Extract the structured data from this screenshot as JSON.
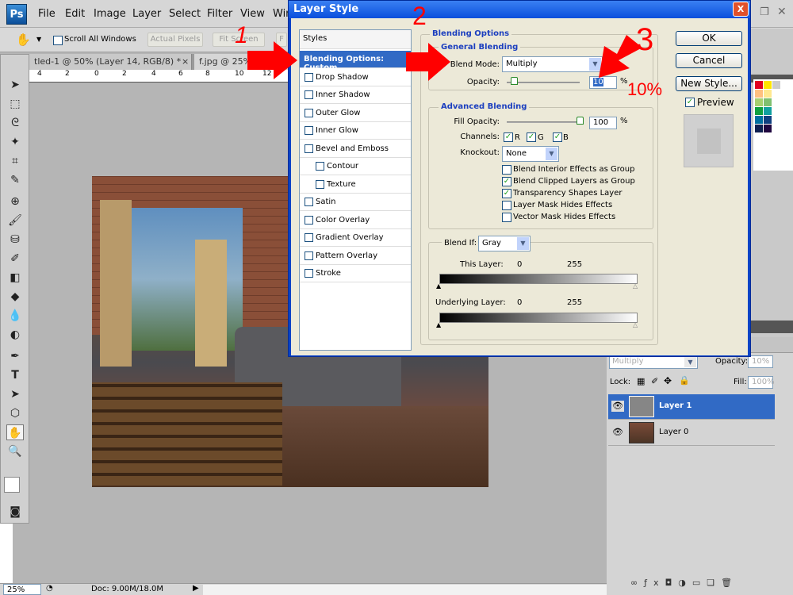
{
  "app": {
    "logo": "Ps",
    "menu": [
      "File",
      "Edit",
      "Image",
      "Layer",
      "Select",
      "Filter",
      "View",
      "Win"
    ]
  },
  "options": {
    "scroll_all": "Scroll All Windows",
    "actual_pixels": "Actual Pixels",
    "fit_screen": "Fit Screen",
    "fill_screen": "F"
  },
  "tabs": [
    {
      "label": "tled-1 @ 50% (Layer 14, RGB/8) *",
      "close": "×"
    },
    {
      "label": "f.jpg @ 25%"
    }
  ],
  "ruler": [
    "4",
    "2",
    "0",
    "2",
    "4",
    "6",
    "8",
    "10",
    "12"
  ],
  "status": {
    "zoom": "25%",
    "doc": "Doc: 9.00M/18.0M"
  },
  "dialog": {
    "title": "Layer Style",
    "close": "X",
    "styles": [
      {
        "label": "Styles",
        "type": "header"
      },
      {
        "label": "Blending Options: Custom",
        "type": "selected"
      },
      {
        "label": "Drop Shadow",
        "checked": false
      },
      {
        "label": "Inner Shadow",
        "checked": false
      },
      {
        "label": "Outer Glow",
        "checked": false
      },
      {
        "label": "Inner Glow",
        "checked": false
      },
      {
        "label": "Bevel and Emboss",
        "checked": false
      },
      {
        "label": "Contour",
        "checked": false,
        "indent": true
      },
      {
        "label": "Texture",
        "checked": false,
        "indent": true
      },
      {
        "label": "Satin",
        "checked": false
      },
      {
        "label": "Color Overlay",
        "checked": false
      },
      {
        "label": "Gradient Overlay",
        "checked": false
      },
      {
        "label": "Pattern Overlay",
        "checked": false
      },
      {
        "label": "Stroke",
        "checked": false
      }
    ],
    "blending_options": "Blending Options",
    "general": {
      "title": "General Blending",
      "blend_mode_label": "Blend Mode:",
      "blend_mode": "Multiply",
      "opacity_label": "Opacity:",
      "opacity": "10",
      "pct": "%",
      "opacity_level": 10
    },
    "advanced": {
      "title": "Advanced Blending",
      "fill_label": "Fill Opacity:",
      "fill": "100",
      "pct": "%",
      "fill_level": 100,
      "channels_label": "Channels:",
      "channels": [
        {
          "label": "R",
          "checked": true
        },
        {
          "label": "G",
          "checked": true
        },
        {
          "label": "B",
          "checked": true
        }
      ],
      "knockout_label": "Knockout:",
      "knockout": "None",
      "options": [
        {
          "label": "Blend Interior Effects as Group",
          "checked": false
        },
        {
          "label": "Blend Clipped Layers as Group",
          "checked": true
        },
        {
          "label": "Transparency Shapes Layer",
          "checked": true
        },
        {
          "label": "Layer Mask Hides Effects",
          "checked": false
        },
        {
          "label": "Vector Mask Hides Effects",
          "checked": false
        }
      ]
    },
    "blend_if": {
      "label": "Blend If:",
      "value": "Gray",
      "this_layer": "This Layer:",
      "underlying": "Underlying Layer:",
      "min": "0",
      "max": "255"
    },
    "buttons": {
      "ok": "OK",
      "cancel": "Cancel",
      "new_style": "New Style...",
      "preview": "Preview",
      "preview_checked": true
    }
  },
  "annotations": {
    "n1": "1",
    "n2": "2",
    "n3": "3",
    "pct": "10%"
  },
  "layers": {
    "blend": "Multiply",
    "opacity_label": "Opacity:",
    "opacity": "10%",
    "lock_label": "Lock:",
    "fill_label": "Fill:",
    "fill": "100%",
    "items": [
      {
        "name": "Layer 1",
        "selected": true,
        "visible": true
      },
      {
        "name": "Layer 0",
        "selected": false,
        "visible": true
      }
    ]
  },
  "colors": {
    "dialog_blue": "#0a4fdc",
    "selection": "#316ac5",
    "annotation": "#ff0000"
  }
}
